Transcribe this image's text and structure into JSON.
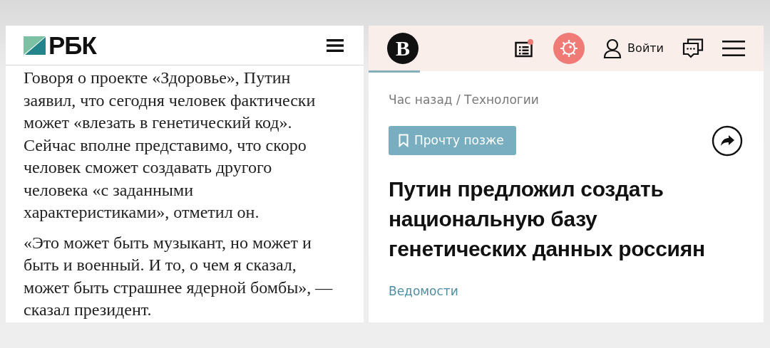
{
  "left_page": {
    "logo": "РБК",
    "paragraphs": [
      "Говоря о проекте «Здоровье», Путин заявил, что сегодня человек фактически может «влезать в генетический код». Сейчас вполне представимо, что скоро человек сможет создавать другого человека «с заданными характеристиками», отметил он.",
      "«Это может быть музыкант, но может и быть и военный. И то, о чем я сказал, может быть страшнее ядерной бомбы», — сказал президент."
    ]
  },
  "right_page": {
    "logo": "В",
    "has_unread": true,
    "login": "Войти",
    "meta": "Час назад / Технологии",
    "read_later": "Прочту позже",
    "headline": "Путин предложил создать национальную базу генетических данных россиян",
    "source": "Ведомости"
  }
}
